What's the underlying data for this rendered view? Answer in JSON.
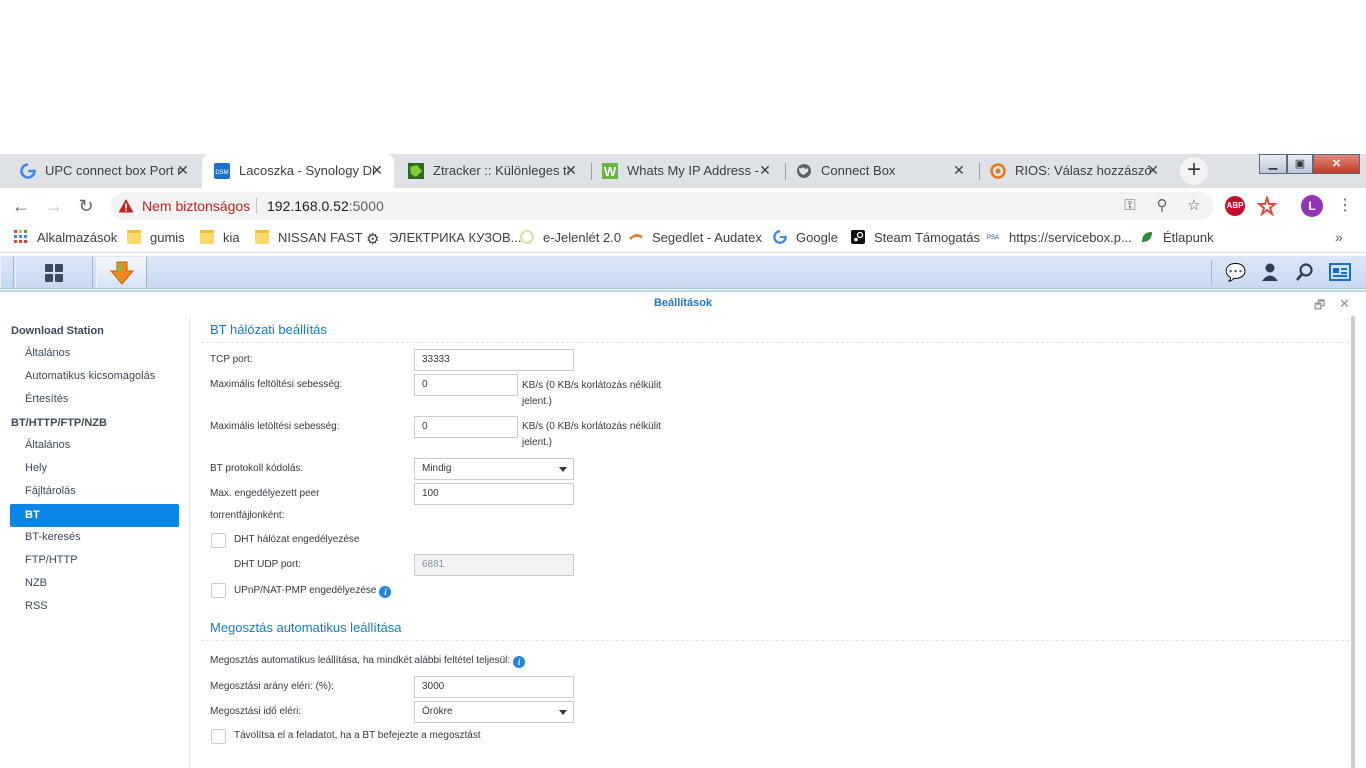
{
  "browser": {
    "tabs": [
      {
        "title": "UPC connect box Port ny",
        "favicon": "google-icon"
      },
      {
        "title": "Lacoszka - Synology Disk",
        "favicon": "dsm-icon"
      },
      {
        "title": "Ztracker :: Különleges tar",
        "favicon": "ztracker-icon"
      },
      {
        "title": "Whats My IP Address - IP",
        "favicon": "w-icon"
      },
      {
        "title": "Connect Box",
        "favicon": "globe-icon"
      },
      {
        "title": "RIOS: Válasz hozzászólás",
        "favicon": "rios-icon"
      }
    ],
    "close_glyph": "✕",
    "new_tab_glyph": "+",
    "security_text": "Nem biztonságos",
    "url_host": "192.168.0.52",
    "url_port": ":5000",
    "avatar_letter": "L",
    "abp_label": "ABP",
    "bookmarks": [
      {
        "label": "Alkalmazások",
        "icon": "apps-grid-icon"
      },
      {
        "label": "gumis",
        "icon": "folder-icon"
      },
      {
        "label": "kia",
        "icon": "folder-icon"
      },
      {
        "label": "NISSAN FAST",
        "icon": "folder-icon"
      },
      {
        "label": "ЭЛЕКТРИКА КУЗОВ...",
        "icon": "gear-icon"
      },
      {
        "label": "e-Jelenlét 2.0",
        "icon": "circle-icon"
      },
      {
        "label": "Segedlet - Audatex",
        "icon": "swoosh-icon"
      },
      {
        "label": "Google",
        "icon": "google-icon"
      },
      {
        "label": "Steam Támogatás",
        "icon": "steam-icon"
      },
      {
        "label": "https://servicebox.p...",
        "icon": "psa-icon"
      },
      {
        "label": "Étlapunk",
        "icon": "leaf-icon"
      }
    ],
    "more_glyph": "»"
  },
  "dsm": {
    "window_title": "Beállítások",
    "sidebar": {
      "group1": "Download Station",
      "group1_items": [
        "Általános",
        "Automatikus kicsomagolás",
        "Értesítés"
      ],
      "group2": "BT/HTTP/FTP/NZB",
      "group2_items": [
        "Általános",
        "Hely",
        "Fájltárolás",
        "BT",
        "BT-keresés",
        "FTP/HTTP",
        "NZB",
        "RSS"
      ],
      "active_item": "BT"
    },
    "bt_section": {
      "title": "BT hálózati beállítás",
      "tcp_port_label": "TCP port:",
      "tcp_port_value": "33333",
      "max_upload_label": "Maximális feltöltési sebesség:",
      "max_upload_value": "0",
      "max_upload_unit_1": "KB/s (0 KB/s korlátozás nélkülit",
      "max_upload_unit_2": "jelent.)",
      "max_download_label": "Maximális letöltési sebesség:",
      "max_download_value": "0",
      "max_download_unit_1": "KB/s (0 KB/s korlátozás nélkülit",
      "max_download_unit_2": "jelent.)",
      "encoding_label": "BT protokoll kódolás:",
      "encoding_value": "Mindig",
      "max_peer_label_1": "Max. engedélyezett peer",
      "max_peer_label_2": "torrentfájlonként:",
      "max_peer_value": "100",
      "dht_enable_label": "DHT hálózat engedélyezése",
      "dht_enable_checked": false,
      "dht_port_label": "DHT UDP port:",
      "dht_port_value": "6881",
      "upnp_label": "UPnP/NAT-PMP engedélyezése",
      "upnp_checked": false,
      "info_glyph": "i"
    },
    "share_section": {
      "title": "Megosztás automatikus leállítása",
      "description": "Megosztás automatikus leállítása, ha mindkét alábbi feltétel teljesül:",
      "ratio_label": "Megosztási arány eléri: (%):",
      "ratio_value": "3000",
      "time_label": "Megosztási idő eléri:",
      "time_value": "Örökre",
      "remove_label": "Távolítsa el a feladatot, ha a BT befejezte a megosztást",
      "remove_checked": false
    }
  },
  "colors": {
    "accent": "#0b86e4",
    "title_blue": "#2176c9",
    "insecure_red": "#c5221f"
  }
}
